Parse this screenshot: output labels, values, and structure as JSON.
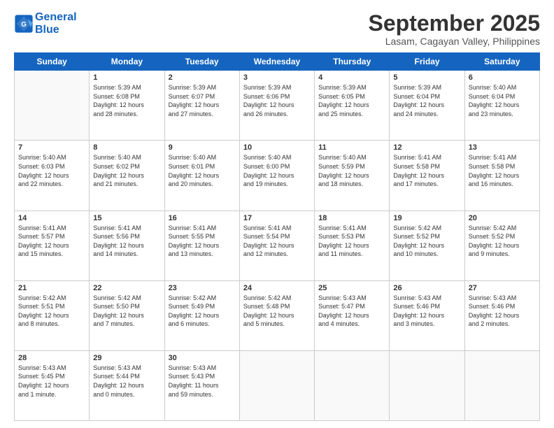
{
  "logo": {
    "line1": "General",
    "line2": "Blue"
  },
  "title": "September 2025",
  "location": "Lasam, Cagayan Valley, Philippines",
  "days_header": [
    "Sunday",
    "Monday",
    "Tuesday",
    "Wednesday",
    "Thursday",
    "Friday",
    "Saturday"
  ],
  "weeks": [
    [
      {
        "num": "",
        "info": ""
      },
      {
        "num": "1",
        "info": "Sunrise: 5:39 AM\nSunset: 6:08 PM\nDaylight: 12 hours\nand 28 minutes."
      },
      {
        "num": "2",
        "info": "Sunrise: 5:39 AM\nSunset: 6:07 PM\nDaylight: 12 hours\nand 27 minutes."
      },
      {
        "num": "3",
        "info": "Sunrise: 5:39 AM\nSunset: 6:06 PM\nDaylight: 12 hours\nand 26 minutes."
      },
      {
        "num": "4",
        "info": "Sunrise: 5:39 AM\nSunset: 6:05 PM\nDaylight: 12 hours\nand 25 minutes."
      },
      {
        "num": "5",
        "info": "Sunrise: 5:39 AM\nSunset: 6:04 PM\nDaylight: 12 hours\nand 24 minutes."
      },
      {
        "num": "6",
        "info": "Sunrise: 5:40 AM\nSunset: 6:04 PM\nDaylight: 12 hours\nand 23 minutes."
      }
    ],
    [
      {
        "num": "7",
        "info": "Sunrise: 5:40 AM\nSunset: 6:03 PM\nDaylight: 12 hours\nand 22 minutes."
      },
      {
        "num": "8",
        "info": "Sunrise: 5:40 AM\nSunset: 6:02 PM\nDaylight: 12 hours\nand 21 minutes."
      },
      {
        "num": "9",
        "info": "Sunrise: 5:40 AM\nSunset: 6:01 PM\nDaylight: 12 hours\nand 20 minutes."
      },
      {
        "num": "10",
        "info": "Sunrise: 5:40 AM\nSunset: 6:00 PM\nDaylight: 12 hours\nand 19 minutes."
      },
      {
        "num": "11",
        "info": "Sunrise: 5:40 AM\nSunset: 5:59 PM\nDaylight: 12 hours\nand 18 minutes."
      },
      {
        "num": "12",
        "info": "Sunrise: 5:41 AM\nSunset: 5:58 PM\nDaylight: 12 hours\nand 17 minutes."
      },
      {
        "num": "13",
        "info": "Sunrise: 5:41 AM\nSunset: 5:58 PM\nDaylight: 12 hours\nand 16 minutes."
      }
    ],
    [
      {
        "num": "14",
        "info": "Sunrise: 5:41 AM\nSunset: 5:57 PM\nDaylight: 12 hours\nand 15 minutes."
      },
      {
        "num": "15",
        "info": "Sunrise: 5:41 AM\nSunset: 5:56 PM\nDaylight: 12 hours\nand 14 minutes."
      },
      {
        "num": "16",
        "info": "Sunrise: 5:41 AM\nSunset: 5:55 PM\nDaylight: 12 hours\nand 13 minutes."
      },
      {
        "num": "17",
        "info": "Sunrise: 5:41 AM\nSunset: 5:54 PM\nDaylight: 12 hours\nand 12 minutes."
      },
      {
        "num": "18",
        "info": "Sunrise: 5:41 AM\nSunset: 5:53 PM\nDaylight: 12 hours\nand 11 minutes."
      },
      {
        "num": "19",
        "info": "Sunrise: 5:42 AM\nSunset: 5:52 PM\nDaylight: 12 hours\nand 10 minutes."
      },
      {
        "num": "20",
        "info": "Sunrise: 5:42 AM\nSunset: 5:52 PM\nDaylight: 12 hours\nand 9 minutes."
      }
    ],
    [
      {
        "num": "21",
        "info": "Sunrise: 5:42 AM\nSunset: 5:51 PM\nDaylight: 12 hours\nand 8 minutes."
      },
      {
        "num": "22",
        "info": "Sunrise: 5:42 AM\nSunset: 5:50 PM\nDaylight: 12 hours\nand 7 minutes."
      },
      {
        "num": "23",
        "info": "Sunrise: 5:42 AM\nSunset: 5:49 PM\nDaylight: 12 hours\nand 6 minutes."
      },
      {
        "num": "24",
        "info": "Sunrise: 5:42 AM\nSunset: 5:48 PM\nDaylight: 12 hours\nand 5 minutes."
      },
      {
        "num": "25",
        "info": "Sunrise: 5:43 AM\nSunset: 5:47 PM\nDaylight: 12 hours\nand 4 minutes."
      },
      {
        "num": "26",
        "info": "Sunrise: 5:43 AM\nSunset: 5:46 PM\nDaylight: 12 hours\nand 3 minutes."
      },
      {
        "num": "27",
        "info": "Sunrise: 5:43 AM\nSunset: 5:46 PM\nDaylight: 12 hours\nand 2 minutes."
      }
    ],
    [
      {
        "num": "28",
        "info": "Sunrise: 5:43 AM\nSunset: 5:45 PM\nDaylight: 12 hours\nand 1 minute."
      },
      {
        "num": "29",
        "info": "Sunrise: 5:43 AM\nSunset: 5:44 PM\nDaylight: 12 hours\nand 0 minutes."
      },
      {
        "num": "30",
        "info": "Sunrise: 5:43 AM\nSunset: 5:43 PM\nDaylight: 11 hours\nand 59 minutes."
      },
      {
        "num": "",
        "info": ""
      },
      {
        "num": "",
        "info": ""
      },
      {
        "num": "",
        "info": ""
      },
      {
        "num": "",
        "info": ""
      }
    ]
  ]
}
